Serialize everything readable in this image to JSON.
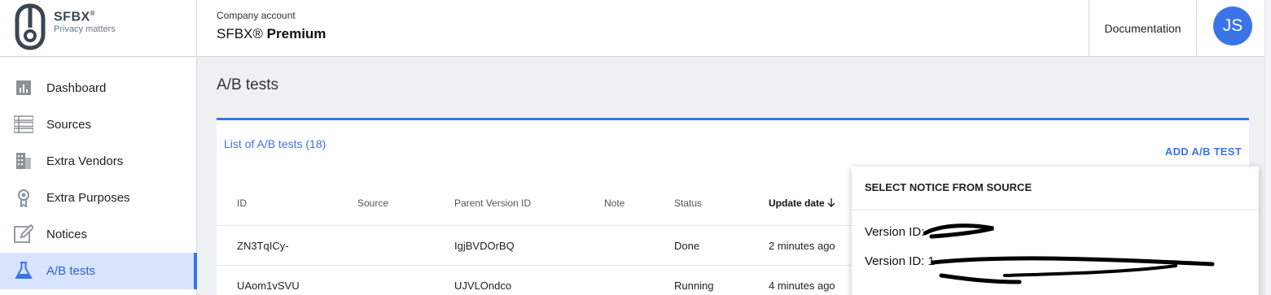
{
  "brand": {
    "name": "SFBX",
    "tagline": "Privacy matters"
  },
  "account": {
    "label": "Company account",
    "name_prefix": "SFBX®",
    "name_strong": "Premium"
  },
  "header": {
    "documentation": "Documentation",
    "avatar_initials": "JS"
  },
  "sidebar": {
    "items": [
      {
        "label": "Dashboard",
        "icon": "bar-chart-icon"
      },
      {
        "label": "Sources",
        "icon": "list-icon"
      },
      {
        "label": "Extra Vendors",
        "icon": "building-icon"
      },
      {
        "label": "Extra Purposes",
        "icon": "award-icon"
      },
      {
        "label": "Notices",
        "icon": "edit-icon"
      },
      {
        "label": "A/B tests",
        "icon": "flask-icon",
        "active": true
      }
    ]
  },
  "main": {
    "title": "A/B tests",
    "list_title": "List of A/B tests (18)",
    "add_button": "ADD A/B TEST",
    "columns": [
      "ID",
      "Source",
      "Parent Version ID",
      "Note",
      "Status",
      "Update date"
    ],
    "sorted_column": "Update date",
    "rows": [
      {
        "id": "ZN3TqICy-",
        "source": "",
        "parent": "IgjBVDOrBQ",
        "note": "",
        "status": "Done",
        "updated": "2 minutes ago"
      },
      {
        "id": "UAom1vSVU",
        "source": "",
        "parent": "UJVLOndco",
        "note": "",
        "status": "Running",
        "updated": "4 minutes ago"
      }
    ]
  },
  "popup": {
    "title": "SELECT NOTICE FROM SOURCE",
    "items": [
      {
        "label": "Version ID:"
      },
      {
        "label": "Version ID: 1"
      }
    ]
  },
  "colors": {
    "accent": "#3a74e6",
    "active_bg": "#d8e4fb",
    "avatar": "#3a74e6"
  }
}
